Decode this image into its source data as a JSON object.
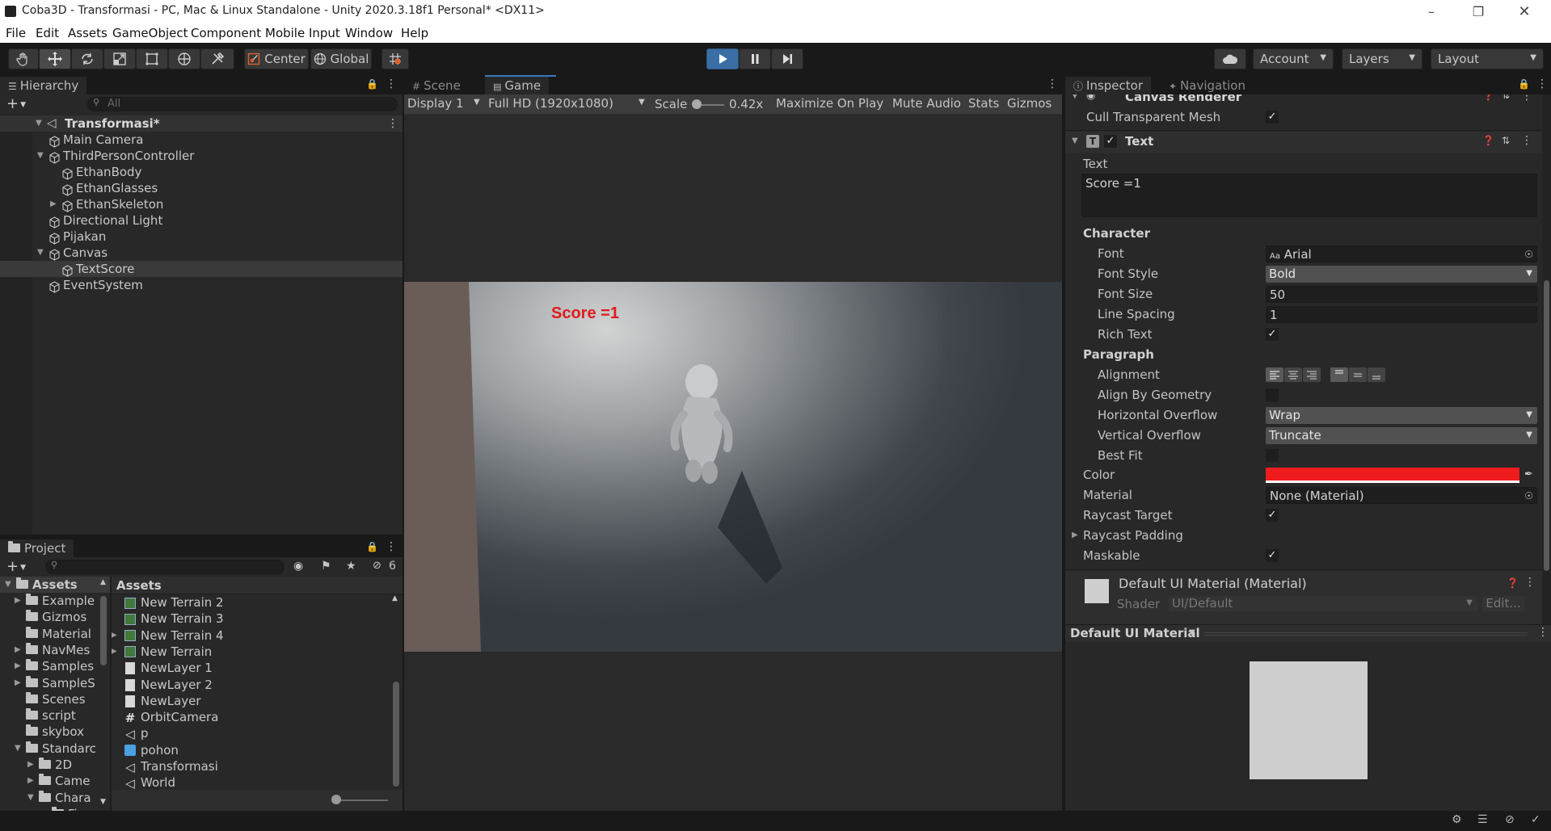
{
  "window": {
    "title": "Coba3D - Transformasi - PC, Mac & Linux Standalone - Unity 2020.3.18f1 Personal* <DX11>"
  },
  "menu": [
    "File",
    "Edit",
    "Assets",
    "GameObject",
    "Component",
    "Mobile Input",
    "Window",
    "Help"
  ],
  "toolbar": {
    "pivot_label": "Center",
    "space_label": "Global",
    "account_label": "Account",
    "layers_label": "Layers",
    "layout_label": "Layout"
  },
  "hierarchy": {
    "tab_label": "Hierarchy",
    "search_placeholder": "All",
    "scene_name": "Transformasi*",
    "items": [
      {
        "label": "Main Camera",
        "depth": 1
      },
      {
        "label": "ThirdPersonController",
        "depth": 1,
        "expanded": true
      },
      {
        "label": "EthanBody",
        "depth": 2
      },
      {
        "label": "EthanGlasses",
        "depth": 2
      },
      {
        "label": "EthanSkeleton",
        "depth": 2,
        "collapsed": true
      },
      {
        "label": "Directional Light",
        "depth": 1
      },
      {
        "label": "Pijakan",
        "depth": 1
      },
      {
        "label": "Canvas",
        "depth": 1,
        "expanded": true
      },
      {
        "label": "TextScore",
        "depth": 2,
        "selected": true
      },
      {
        "label": "EventSystem",
        "depth": 1
      }
    ]
  },
  "project": {
    "tab_label": "Project",
    "hidden_count": "6",
    "tree_root": "Assets",
    "folders": [
      "Example",
      "Gizmos",
      "Material",
      "NavMes",
      "Samples",
      "SampleS",
      "Scenes",
      "script",
      "skybox",
      "Standarc",
      "2D",
      "Came",
      "Chara",
      "Fir"
    ],
    "breadcrumb": "Assets",
    "files": [
      "New Terrain 2",
      "New Terrain 3",
      "New Terrain 4",
      "New Terrain",
      "NewLayer 1",
      "NewLayer 2",
      "NewLayer",
      "OrbitCamera",
      "p",
      "pohon",
      "Transformasi",
      "World"
    ]
  },
  "game": {
    "scene_tab": "Scene",
    "game_tab": "Game",
    "display": "Display 1",
    "resolution": "Full HD (1920x1080)",
    "scale_label": "Scale",
    "scale_value": "0.42x",
    "maximize": "Maximize On Play",
    "mute": "Mute Audio",
    "stats": "Stats",
    "gizmos": "Gizmos",
    "score_text": "Score =1"
  },
  "inspector": {
    "tab_label": "Inspector",
    "nav_tab_label": "Navigation",
    "canvas_renderer": "Canvas Renderer",
    "cull_label": "Cull Transparent Mesh",
    "text_component": "Text",
    "text_label": "Text",
    "text_value": "Score =1",
    "character_header": "Character",
    "font_label": "Font",
    "font_value": "Arial",
    "font_style_label": "Font Style",
    "font_style_value": "Bold",
    "font_size_label": "Font Size",
    "font_size_value": "50",
    "line_spacing_label": "Line Spacing",
    "line_spacing_value": "1",
    "rich_text_label": "Rich Text",
    "paragraph_header": "Paragraph",
    "alignment_label": "Alignment",
    "align_geometry_label": "Align By Geometry",
    "h_overflow_label": "Horizontal Overflow",
    "h_overflow_value": "Wrap",
    "v_overflow_label": "Vertical Overflow",
    "v_overflow_value": "Truncate",
    "best_fit_label": "Best Fit",
    "color_label": "Color",
    "color_value": "#ee1c1c",
    "material_label": "Material",
    "material_value": "None (Material)",
    "raycast_target_label": "Raycast Target",
    "raycast_padding_label": "Raycast Padding",
    "maskable_label": "Maskable",
    "default_material": "Default UI Material (Material)",
    "shader_label": "Shader",
    "shader_value": "UI/Default",
    "edit_label": "Edit...",
    "preview_title": "Default UI Material"
  }
}
